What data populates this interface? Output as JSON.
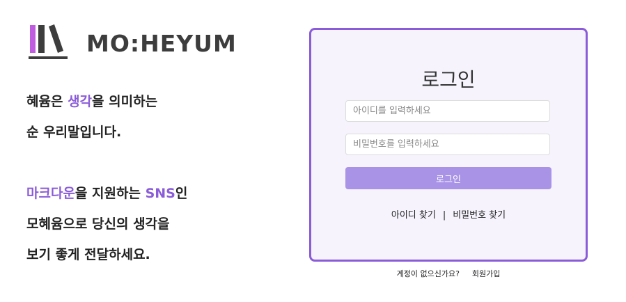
{
  "brand": {
    "name": "MO:HEYUM",
    "colors": {
      "accent": "#8a5cd8",
      "book_purple": "#c05ce0",
      "book_gray": "#3d3d3d",
      "button": "#a993e6",
      "card_bg": "#f6f3fd"
    },
    "icon": "books-icon"
  },
  "intro": {
    "line1": {
      "a": "혜윰은 ",
      "b": "생각",
      "c": "을 의미하는"
    },
    "line2": "순 우리말입니다.",
    "line3": {
      "a": "마크다운",
      "b": "을 지원하는 ",
      "c": "SNS",
      "d": "인"
    },
    "line4": "모혜윰으로 당신의 생각을",
    "line5": "보기 좋게 전달하세요."
  },
  "login": {
    "title": "로그인",
    "id_placeholder": "아이디를 입력하세요",
    "id_value": "",
    "pw_placeholder": "비밀번호를 입력하세요",
    "pw_value": "",
    "button_label": "로그인",
    "find_id": "아이디 찾기",
    "separator": "|",
    "find_pw": "비밀번호 찾기"
  },
  "signup": {
    "question": "계정이 없으신가요?",
    "link": "회원가입"
  }
}
